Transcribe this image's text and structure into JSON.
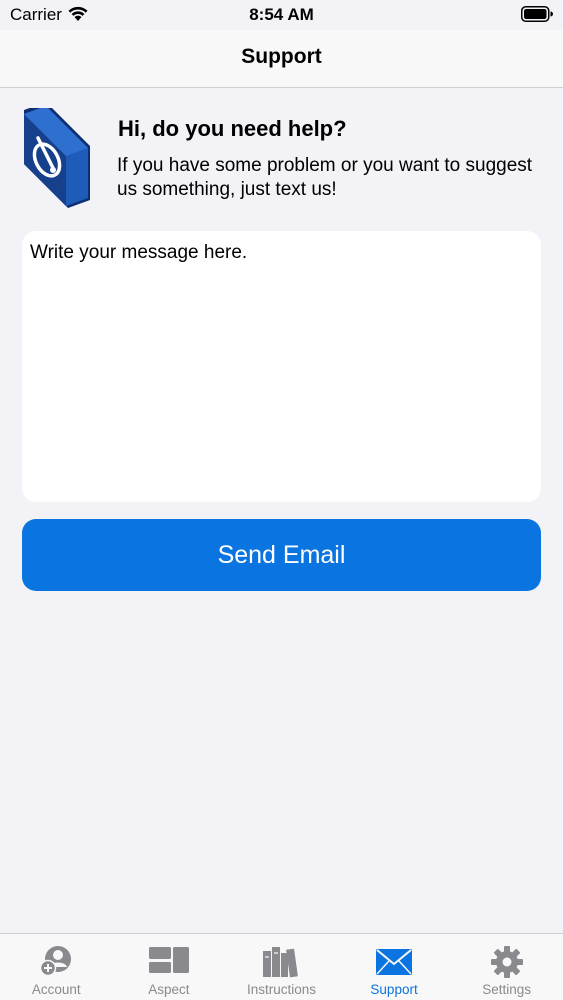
{
  "status_bar": {
    "carrier": "Carrier",
    "time": "8:54 AM"
  },
  "nav": {
    "title": "Support"
  },
  "help": {
    "title": "Hi, do you need help?",
    "text": "If you have some problem or you want to suggest us something, just text us!"
  },
  "message": {
    "placeholder": "Write your message here.",
    "value": ""
  },
  "send_button": {
    "label": "Send Email"
  },
  "tabs": [
    {
      "label": "Account",
      "icon": "account-icon",
      "active": false
    },
    {
      "label": "Aspect",
      "icon": "aspect-icon",
      "active": false
    },
    {
      "label": "Instructions",
      "icon": "books-icon",
      "active": false
    },
    {
      "label": "Support",
      "icon": "envelope-icon",
      "active": true
    },
    {
      "label": "Settings",
      "icon": "gear-icon",
      "active": false
    }
  ],
  "colors": {
    "accent": "#0a74e0",
    "inactive": "#8a8a8e",
    "background": "#f2f2f7",
    "icon_blue": "#1d4fa3"
  }
}
